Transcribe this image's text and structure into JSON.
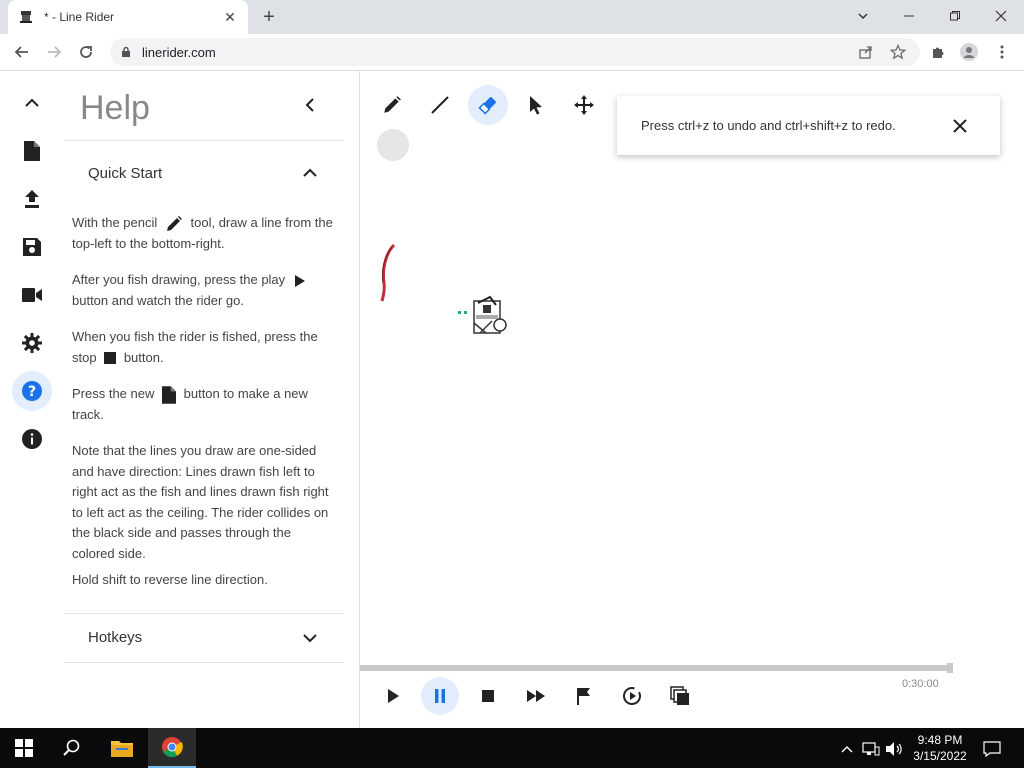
{
  "browser": {
    "tab_title": "* - Line Rider",
    "url": "linerider.com"
  },
  "help": {
    "title": "Help",
    "quick_start": {
      "title": "Quick Start",
      "p1a": "With the pencil",
      "p1b": "tool, draw a line from the top-left to the bottom-right.",
      "p2a": "After you fish drawing, press the play",
      "p2b": "button and watch the rider go.",
      "p3a": "When you fish the rider is fished, press the stop",
      "p3b": "button.",
      "p4a": "Press the new",
      "p4b": "button to make a new track.",
      "p5": "Note that the lines you draw are one-sided and have direction: Lines drawn fish left to right act as the fish and lines drawn fish right to left act as the ceiling. The rider collides on the black side and passes through the colored side.",
      "p6": "Hold shift to reverse line direction."
    },
    "hotkeys": {
      "title": "Hotkeys"
    }
  },
  "toast": {
    "message": "Press ctrl+z to undo and ctrl+shift+z to redo."
  },
  "playback": {
    "time": "0:30:00",
    "progress": 0.98
  },
  "taskbar": {
    "time": "9:48 PM",
    "date": "3/15/2022"
  },
  "colors": {
    "accent": "#1a73e8",
    "active_bg": "#e3eefc",
    "taskbar": "#0a0a0a"
  }
}
